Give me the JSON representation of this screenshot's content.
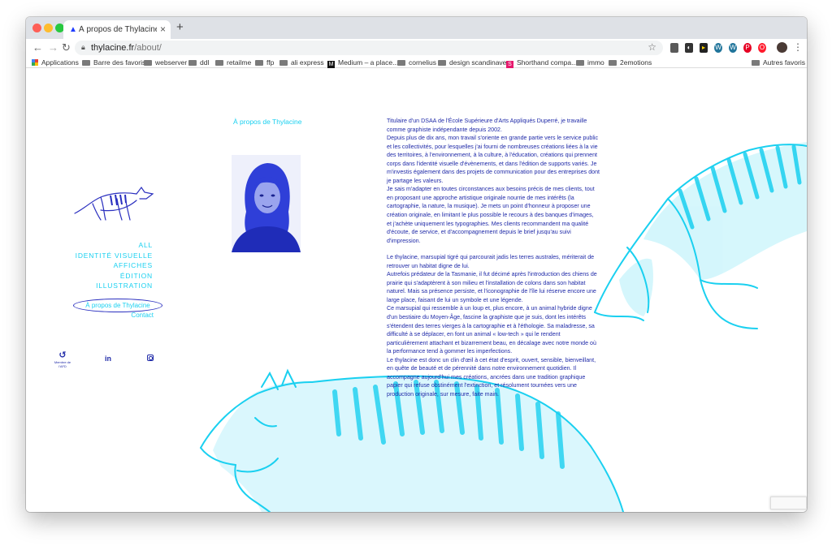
{
  "browser": {
    "tab": {
      "title": "À propos de Thylacine - Thyla..."
    },
    "address": {
      "domain": "thylacine.fr",
      "path": "/about/"
    },
    "bookmarks": [
      "Applications",
      "Barre des favoris",
      "webserver",
      "ddl",
      "retailme",
      "ffp",
      "ali express",
      "Medium – a place...",
      "cornelius",
      "design scandinave",
      "Shorthand compa...",
      "immo",
      "2emotions",
      "Autres favoris"
    ]
  },
  "site": {
    "nav": [
      "ALL",
      "IDENTITÉ VISUELLE",
      "AFFICHES",
      "ÉDITION",
      "ILLUSTRATION"
    ],
    "about_link": "À propos de Thylacine",
    "contact_link": "Contact",
    "membre_label": "Membre de l'AFD",
    "heading": "À propos de Thylacine",
    "paragraphs": [
      "Titulaire d'un DSAA de l'École Supérieure d'Arts Appliqués Duperré, je travaille comme graphiste indépendante depuis 2002.",
      "Depuis plus de dix ans, mon travail s'oriente en grande partie vers le service public et les collectivités, pour lesquelles j'ai fourni de nombreuses créations liées à la vie des territoires, à l'environnement, à la culture, à l'éducation, créations qui prennent corps dans l'identité visuelle d'évènements, et dans l'édition de supports variés. Je m'investis également dans des projets de communication pour des entreprises dont je partage les valeurs.",
      "Je sais m'adapter en toutes circonstances aux besoins précis de mes clients, tout en proposant une approche artistique originale nourrie de mes intérêts (la cartographie, la nature, la musique). Je mets un point d'honneur à proposer une création originale, en limitant le plus possible le recours à des banques d'images, et j'achète uniquement les typographies. Mes clients recommandent ma qualité d'écoute, de service, et d'accompagnement depuis le brief jusqu'au suivi d'impression.",
      "Le thylacine, marsupial tigré qui parcourait jadis les terres australes, mériterait de retrouver un habitat digne de lui.",
      "Autrefois prédateur de la Tasmanie, il fut décimé après l'introduction des chiens de prairie qui s'adaptèrent à son milieu et l'installation de colons dans son habitat naturel. Mais sa présence persiste, et l'iconographie de l'île lui réserve encore une large place, faisant de lui un symbole et une légende.",
      "Ce marsupial qui ressemble à un loup et, plus encore, à un animal hybride digne d'un bestiaire du Moyen-Âge, fascine la graphiste que je suis, dont les intérêts s'étendent des terres vierges à la cartographie et à l'éthologie. Sa maladresse, sa difficulté à se déplacer, en font un animal « low-tech » qui le rendent particulièrement attachant et bizarrement beau, en décalage avec notre monde où la performance tend à gommer les imperfections.",
      "Le thylacine est donc un clin d'œil à cet état d'esprit, ouvert, sensible, bienveillant, en quête de beauté et de pérennité dans notre environnement quotidien. Il accompagne aujourd'hui mes créations, ancrées dans une tradition graphique papier qui refuse obstinément l'extinction, et résolument tournées vers une production originale, sur mesure, faite main."
    ]
  },
  "colors": {
    "accent": "#1ad0f0",
    "ink": "#1f2aa8",
    "portrait_tint": "#2f3fd8"
  },
  "icons": {
    "back": "arrow-left-icon",
    "forward": "arrow-right-icon",
    "reload": "reload-icon",
    "lock": "lock-icon",
    "star": "star-icon",
    "linkedin": "linkedin-icon",
    "instagram": "instagram-icon"
  }
}
